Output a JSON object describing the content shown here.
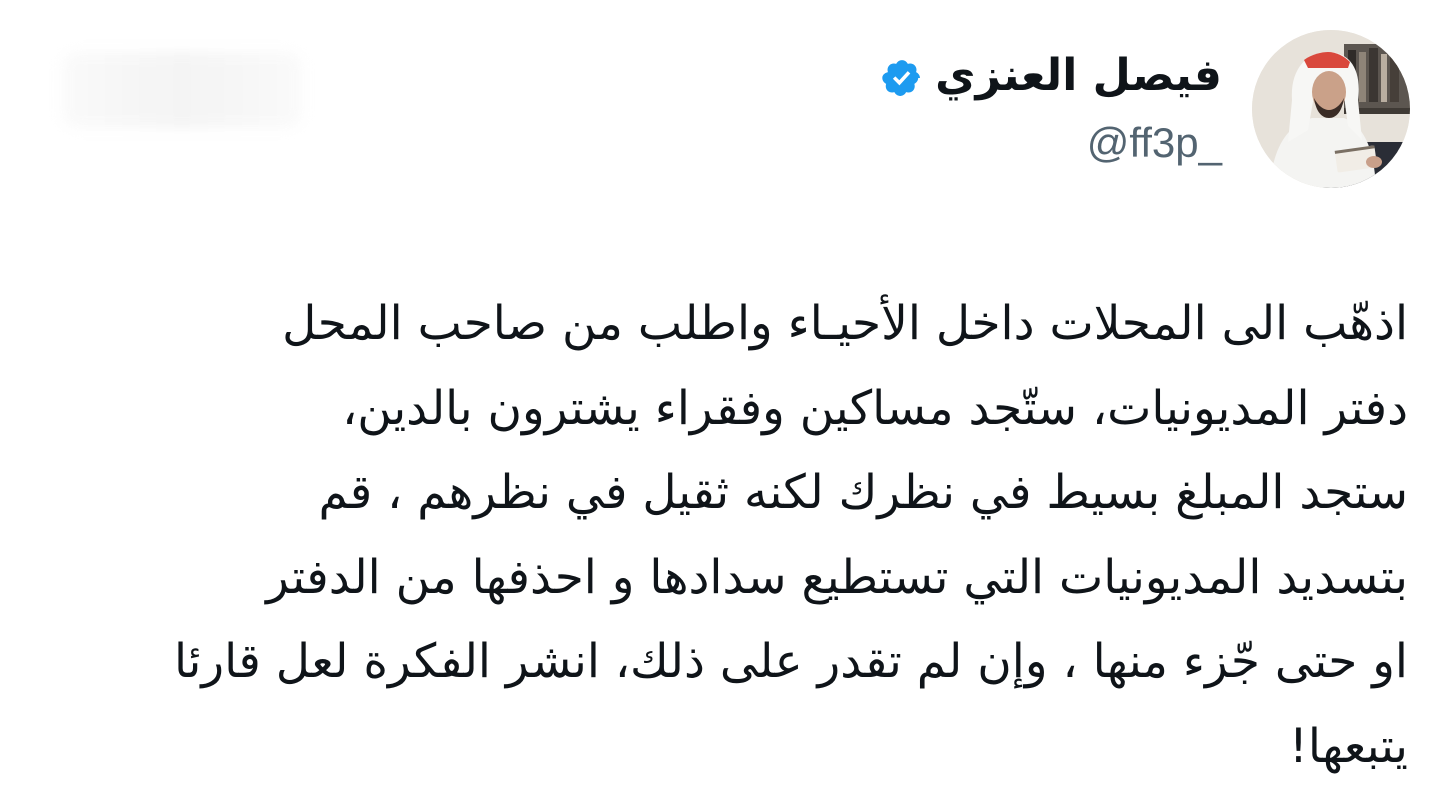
{
  "author": {
    "display_name": "فيصل العنزي",
    "handle": "@ff3p_",
    "verified": true,
    "verified_icon": "verified-badge-icon",
    "badge_color": "#1d9bf0"
  },
  "tweet": {
    "lines": [
      "اذهّب الى المحلات داخل الأحيـاء واطلب من صاحب المحل",
      "دفتر المديونيات، ستّجد مساكين وفقراء يشترون بالدين،",
      "ستجد المبلغ بسيط في نظرك لكنه ثقيل في نظرهم ، قم",
      "بتسديد المديونيات التي تستطيع سدادها و احذفها من الدفتر",
      "او حتى جّزء منها ، وإن لم تقدر على ذلك، انشر الفكرة لعل قارئا",
      "يتبعها!"
    ]
  }
}
